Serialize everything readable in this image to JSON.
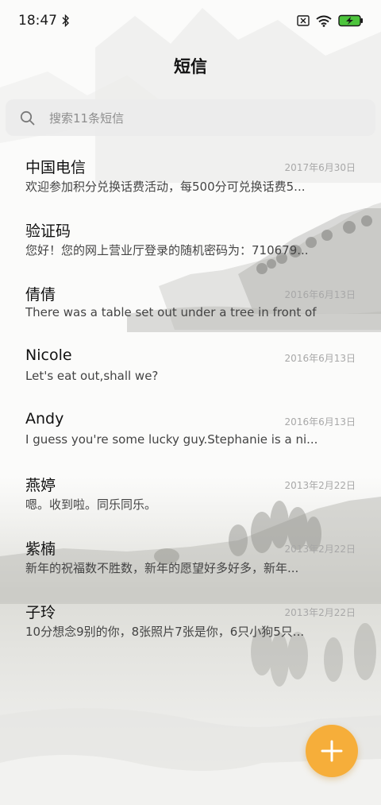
{
  "status": {
    "time": "18:47",
    "icons": [
      "bluetooth-icon",
      "sim-missing-icon",
      "wifi-icon",
      "battery-charging-icon"
    ],
    "battery_color": "#4cc43c"
  },
  "header": {
    "title": "短信"
  },
  "search": {
    "placeholder": "搜索11条短信",
    "icon": "search-icon"
  },
  "conversations": [
    {
      "name": "中国电信",
      "date": "2017年6月30日",
      "preview": "欢迎参加积分兑换话费活动，每500分可兑换话费5..."
    },
    {
      "name": "验证码",
      "date": "",
      "preview": "您好！您的网上营业厅登录的随机密码为：710679..."
    },
    {
      "name": "倩倩",
      "date": "2016年6月13日",
      "preview": "There was a table set out under a tree in front of ..."
    },
    {
      "name": "Nicole",
      "date": "2016年6月13日",
      "preview": "Let's eat out,shall we?"
    },
    {
      "name": "Andy",
      "date": "2016年6月13日",
      "preview": "I guess you're some lucky guy.Stephanie is a ni..."
    },
    {
      "name": "燕婷",
      "date": "2013年2月22日",
      "preview": "嗯。收到啦。同乐同乐。"
    },
    {
      "name": "紫楠",
      "date": "2013年2月22日",
      "preview": "新年的祝福数不胜数，新年的愿望好多好多，新年..."
    },
    {
      "name": "子玲",
      "date": "2013年2月22日",
      "preview": "10分想念9别的你，8张照片7张是你，6只小狗5只..."
    }
  ],
  "fab": {
    "icon": "plus-icon",
    "color": "#f6ae3a"
  }
}
